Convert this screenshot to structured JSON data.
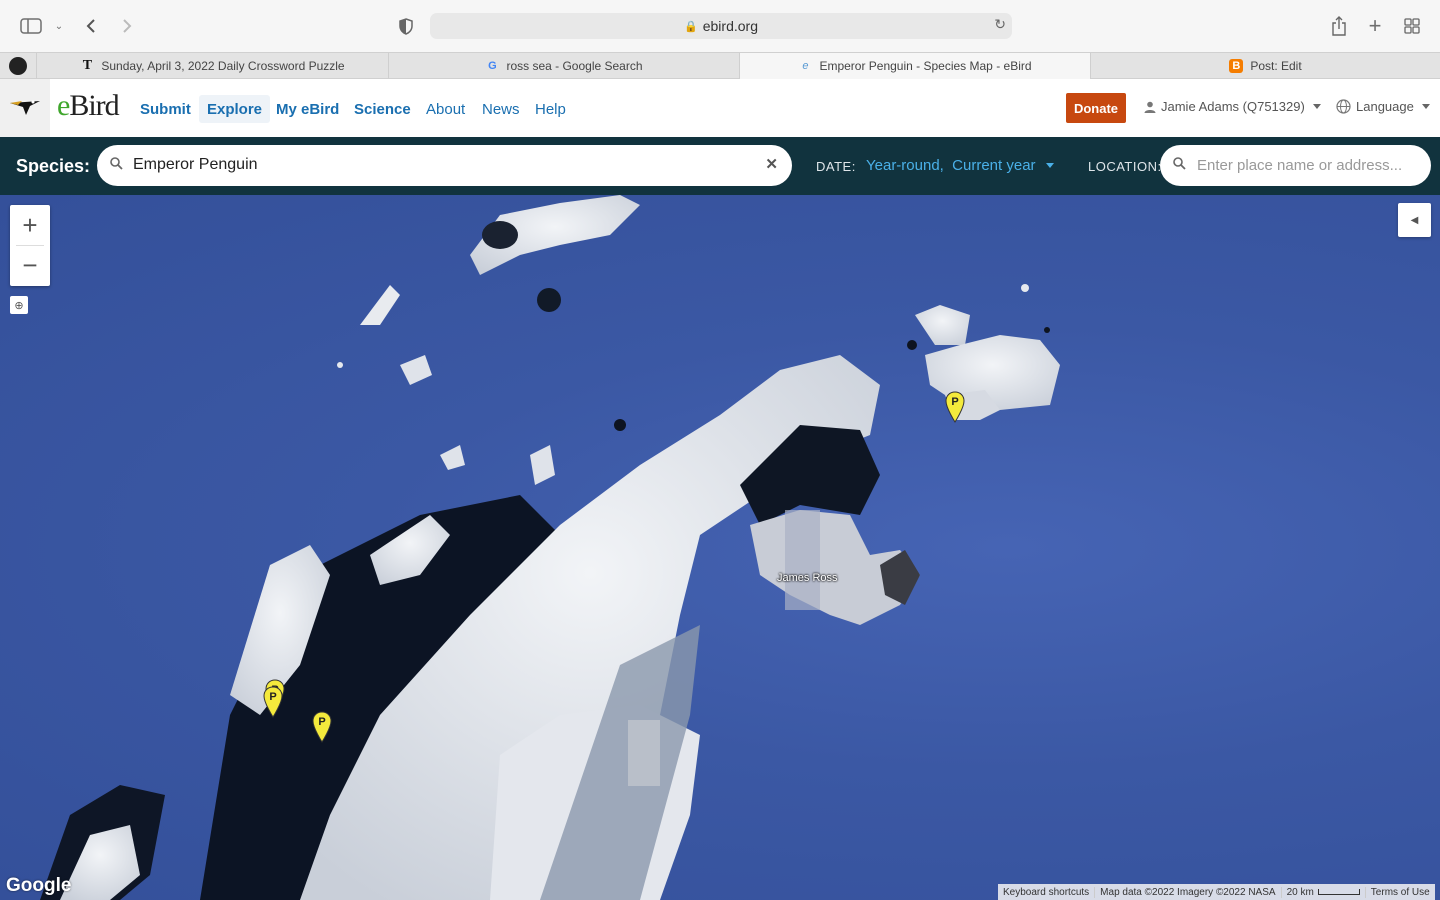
{
  "browser": {
    "address": "ebird.org",
    "tabs": [
      {
        "title": "Sunday, April 3, 2022 Daily Crossword Puzzle",
        "favicon": "T",
        "active": false
      },
      {
        "title": "ross sea - Google Search",
        "favicon": "G",
        "active": false
      },
      {
        "title": "Emperor Penguin - Species Map - eBird",
        "favicon": "e",
        "active": true
      },
      {
        "title": "Post: Edit",
        "favicon": "B",
        "active": false
      }
    ]
  },
  "header": {
    "logo": "eBird",
    "nav": [
      {
        "label": "Submit"
      },
      {
        "label": "Explore"
      },
      {
        "label": "My eBird"
      },
      {
        "label": "Science"
      },
      {
        "label": "About"
      },
      {
        "label": "News"
      },
      {
        "label": "Help"
      }
    ],
    "donate": "Donate",
    "user": "Jamie Adams (Q751329)",
    "language": "Language"
  },
  "search": {
    "species_label": "Species:",
    "species_value": "Emperor Penguin",
    "date_label": "DATE:",
    "date_value": "Year-round,  Current year",
    "location_label": "LOCATION:",
    "location_placeholder": "Enter place name or address..."
  },
  "map": {
    "place_label": "James Ross",
    "provider": "Google",
    "pin_label": "P",
    "attribution": [
      "Keyboard shortcuts",
      "Map data ©2022 Imagery ©2022 NASA",
      "20 km",
      "Terms of Use"
    ]
  },
  "colors": {
    "ocean": "#3b58a4",
    "ice": "#e6e9ee",
    "nav_link": "#1a6fb0",
    "donate": "#c7480f",
    "search_bar": "#11333e",
    "accent": "#4ab0e8"
  }
}
